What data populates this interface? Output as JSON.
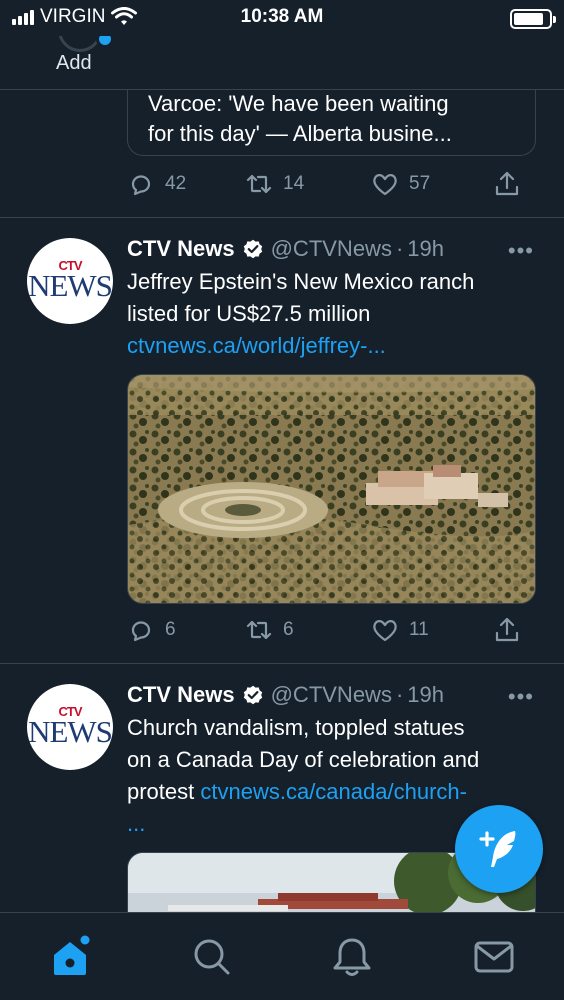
{
  "status_bar": {
    "carrier": "VIRGIN",
    "time": "10:38 AM",
    "battery_level": 0.85
  },
  "fleets": {
    "add_label": "Add"
  },
  "previous_tweet": {
    "quote_text_line1": "Varcoe: 'We have been waiting",
    "quote_text_line2": "for this day' — Alberta busine...",
    "replies": "42",
    "retweets": "14",
    "likes": "57"
  },
  "tweets": [
    {
      "name": "CTV News",
      "handle": "@CTVNews",
      "separator": "·",
      "age": "19h",
      "text_line1": "Jeffrey Epstein's New Mexico ranch",
      "text_line2": "listed for US$27.5 million",
      "link": "ctvnews.ca/world/jeffrey-...",
      "replies": "6",
      "retweets": "6",
      "likes": "11",
      "media_icon": "aerial-ranch-photo"
    },
    {
      "name": "CTV News",
      "handle": "@CTVNews",
      "separator": "·",
      "age": "19h",
      "text_line1": "Church vandalism, toppled statues",
      "text_line2": "on a Canada Day of celebration and",
      "text_line3_plain": "protest ",
      "link": "ctvnews.ca/canada/church-",
      "link_cont": "...",
      "media_icon": "church-photo"
    }
  ],
  "avatar_logo": {
    "top": "CTV",
    "bottom": "NEWS"
  },
  "more_glyph": "•••",
  "tab_bar": {
    "items": [
      "home-icon",
      "search-icon",
      "notifications-icon",
      "messages-icon"
    ],
    "active": "home-icon"
  },
  "colors": {
    "background": "#15202b",
    "accent": "#1da1f2",
    "muted": "#8899a6",
    "divider": "#38444d"
  }
}
